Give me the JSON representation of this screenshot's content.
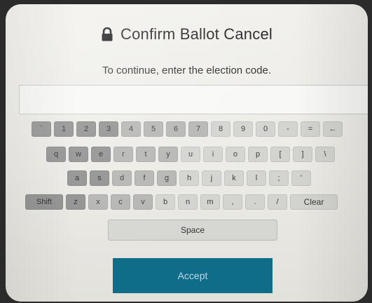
{
  "dialog": {
    "title": "Confirm Ballot Cancel",
    "instruction": "To continue, enter the election code.",
    "code_value": "",
    "code_placeholder": ""
  },
  "keyboard": {
    "row_numbers": [
      "`",
      "1",
      "2",
      "3",
      "4",
      "5",
      "6",
      "7",
      "8",
      "9",
      "0",
      "-",
      "=",
      "←"
    ],
    "row_q": [
      "q",
      "w",
      "e",
      "r",
      "t",
      "y",
      "u",
      "i",
      "o",
      "p",
      "[",
      "]",
      "\\"
    ],
    "row_a": [
      "a",
      "s",
      "d",
      "f",
      "g",
      "h",
      "j",
      "k",
      "l",
      ";",
      "'"
    ],
    "row_z": [
      "Shift",
      "z",
      "x",
      "c",
      "v",
      "b",
      "n",
      "m",
      ",",
      ".",
      "/",
      "Clear"
    ],
    "space_label": "Space"
  },
  "actions": {
    "accept_label": "Accept",
    "accept_color": "#0f6d8a"
  },
  "icons": {
    "title_icon": "lock-icon"
  }
}
